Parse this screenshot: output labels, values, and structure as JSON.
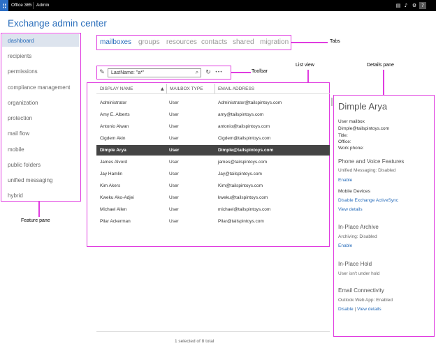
{
  "topbar": {
    "product": "Office 365",
    "section": "Admin",
    "icons": [
      "notebook-icon",
      "bell-icon",
      "gear-icon",
      "help-icon"
    ],
    "help_glyph": "?"
  },
  "app_title": "Exchange admin center",
  "feature_pane": {
    "items": [
      "dashboard",
      "recipients",
      "permissions",
      "compliance management",
      "organization",
      "protection",
      "mail flow",
      "mobile",
      "public folders",
      "unified messaging",
      "hybrid"
    ],
    "active_index": 0
  },
  "tabs": {
    "items": [
      "mailboxes",
      "groups",
      "resources",
      "contacts",
      "shared",
      "migration"
    ],
    "active_index": 0
  },
  "toolbar": {
    "search_value": "LastName: \"a*\"",
    "icons": [
      "edit-icon",
      "search-icon",
      "refresh-icon",
      "more-icon"
    ],
    "more_glyph": "•••"
  },
  "list": {
    "columns": [
      "DISPLAY NAME",
      "MAILBOX TYPE",
      "EMAIL ADDRESS"
    ],
    "rows": [
      {
        "name": "Administrator",
        "type": "User",
        "email": "Administrator@tailspintoys.com"
      },
      {
        "name": "Amy E. Alberts",
        "type": "User",
        "email": "amy@tailspintoys.com"
      },
      {
        "name": "Antonio Alwan",
        "type": "User",
        "email": "antonio@tailspintoys.com"
      },
      {
        "name": "Cigdem Akin",
        "type": "User",
        "email": "Cigdem@tailspintoys.com"
      },
      {
        "name": "Dimple Arya",
        "type": "User",
        "email": "Dimple@tailspintoys.com"
      },
      {
        "name": "James Alvord",
        "type": "User",
        "email": "james@tailspintoys.com"
      },
      {
        "name": "Jay Hamlin",
        "type": "User",
        "email": "Jay@tailspintoys.com"
      },
      {
        "name": "Kim Akers",
        "type": "User",
        "email": "Kim@tailspintoys.com"
      },
      {
        "name": "Kweku Ako-Adjei",
        "type": "User",
        "email": "kweku@tailspintoys.com"
      },
      {
        "name": "Michael Allen",
        "type": "User",
        "email": "michael@tailspintoys.com"
      },
      {
        "name": "Pilar Ackerman",
        "type": "User",
        "email": "Pilar@tailspintoys.com"
      }
    ],
    "selected_index": 4
  },
  "details": {
    "name": "Dimple Arya",
    "kind": "User mailbox",
    "email": "Dimple@tailspintoys.com",
    "title_label": "Title:",
    "office_label": "Office:",
    "phone_label": "Work phone:",
    "phone_voice": {
      "heading": "Phone and Voice Features",
      "um_status": "Unified Messaging: Disabled",
      "enable_link": "Enable"
    },
    "mobile": {
      "heading": "Mobile Devices",
      "disable_link": "Disable Exchange ActiveSync",
      "view_link": "View details"
    },
    "archive": {
      "heading": "In-Place Archive",
      "status": "Archiving: Disabled",
      "enable_link": "Enable"
    },
    "hold": {
      "heading": "In-Place Hold",
      "status": "User isn't under hold"
    },
    "email_conn": {
      "heading": "Email Connectivity",
      "status": "Outlook Web App: Enabled",
      "disable_link": "Disable",
      "separator": "|",
      "view_link": "View details"
    }
  },
  "status_text": "1 selected of 8 total",
  "annotations": {
    "tabs": "Tabs",
    "toolbar": "Toolbar",
    "list_view": "List view",
    "details_pane": "Details pane",
    "feature_pane": "Feature pane"
  }
}
